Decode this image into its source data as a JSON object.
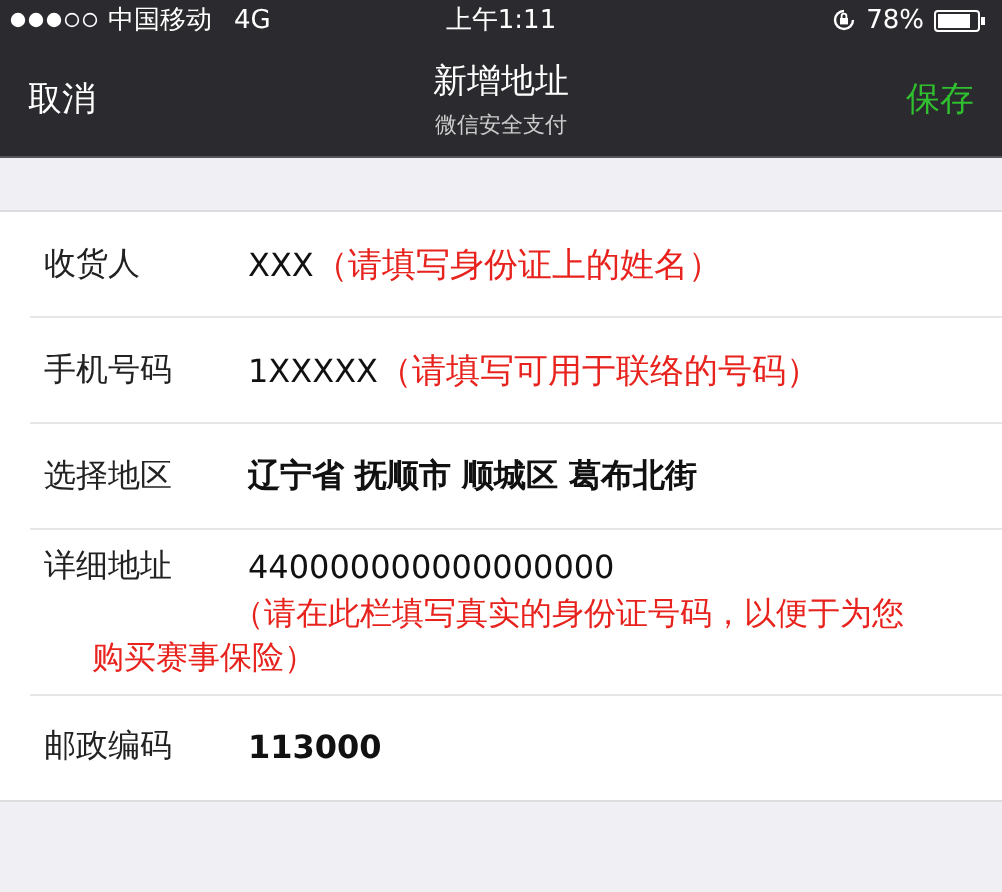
{
  "status_bar": {
    "carrier": "中国移动",
    "network": "4G",
    "time": "上午1:11",
    "battery": "78%"
  },
  "nav": {
    "cancel": "取消",
    "title": "新增地址",
    "subtitle": "微信安全支付",
    "save": "保存"
  },
  "rows": [
    {
      "label": "收货人",
      "value": "XXX",
      "bold": false,
      "note": "（请填写身份证上的姓名）",
      "note_below": false
    },
    {
      "label": "手机号码",
      "value": "1XXXXX",
      "bold": false,
      "note": "（请填写可用于联络的号码）",
      "note_below": false
    },
    {
      "label": "选择地区",
      "value": "辽宁省 抚顺市 顺城区 葛布北街",
      "bold": true
    },
    {
      "label": "详细地址",
      "value": "440000000000000000",
      "bold": false,
      "note": "（请在此栏填写真实的身份证号码，以便于为您购买赛事保险）",
      "note_below": true
    },
    {
      "label": "邮政编码",
      "value": "113000",
      "bold": true
    }
  ]
}
